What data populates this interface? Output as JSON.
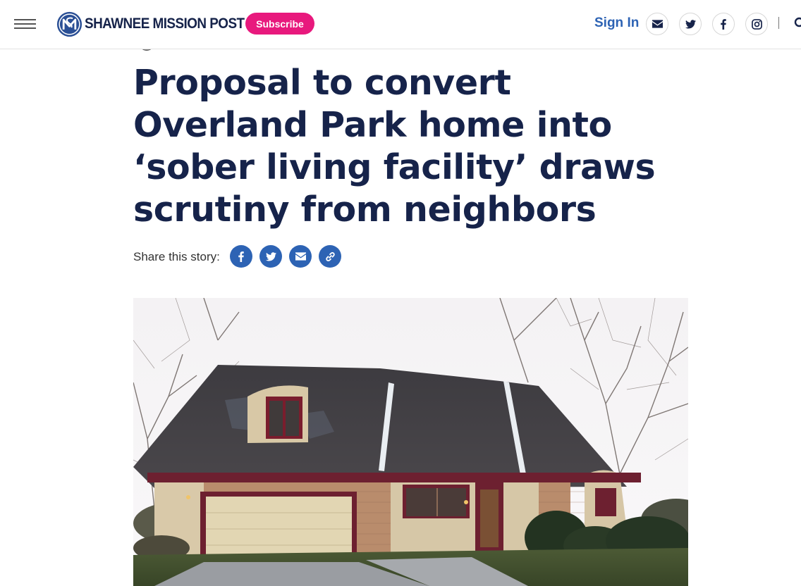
{
  "header": {
    "logo_text": "SHAWNEE MISSION POST",
    "subscribe_label": "Subscribe",
    "signin_label": "Sign In",
    "icons": [
      "menu-icon",
      "email-icon",
      "twitter-icon",
      "facebook-icon",
      "instagram-icon",
      "search-icon"
    ]
  },
  "article": {
    "headline": "Proposal to convert Overland Park home into ‘sober living facility’ draws scrutiny from neighbors",
    "share_label": "Share this story:",
    "share_icons": [
      "facebook-icon",
      "twitter-icon",
      "email-icon",
      "link-icon"
    ]
  },
  "colors": {
    "brand_navy": "#16234a",
    "link_blue": "#2d63b4",
    "subscribe_pink": "#e8197d"
  }
}
